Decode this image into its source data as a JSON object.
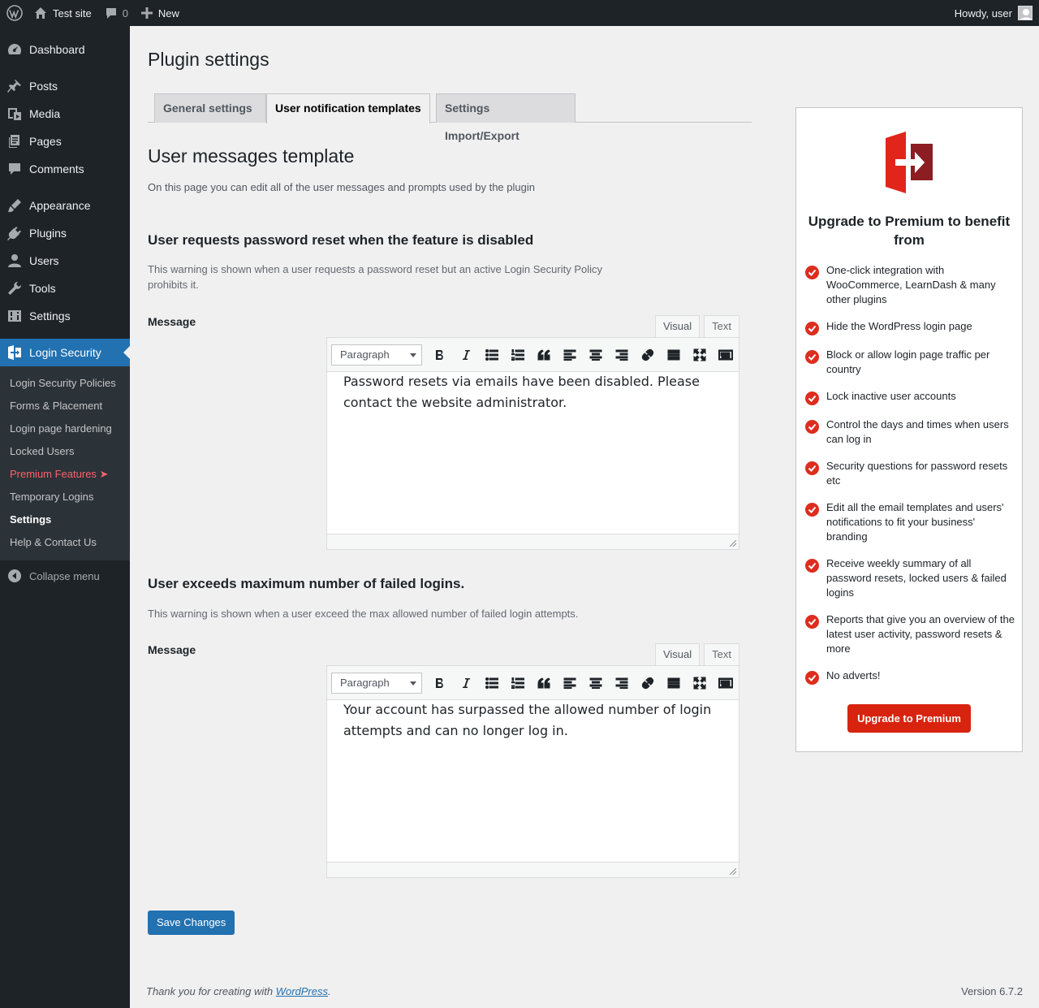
{
  "adminbar": {
    "site_name": "Test site",
    "comments_count": "0",
    "new_label": "New",
    "howdy": "Howdy, user"
  },
  "sidebar": {
    "items": [
      {
        "label": "Dashboard",
        "icon": "dashboard-icon"
      },
      {
        "label": "Posts",
        "icon": "pin-icon"
      },
      {
        "label": "Media",
        "icon": "media-icon"
      },
      {
        "label": "Pages",
        "icon": "pages-icon"
      },
      {
        "label": "Comments",
        "icon": "comment-icon"
      },
      {
        "label": "Appearance",
        "icon": "brush-icon"
      },
      {
        "label": "Plugins",
        "icon": "plug-icon"
      },
      {
        "label": "Users",
        "icon": "user-icon"
      },
      {
        "label": "Tools",
        "icon": "wrench-icon"
      },
      {
        "label": "Settings",
        "icon": "settings-icon"
      },
      {
        "label": "Login Security",
        "icon": "login-security-icon"
      }
    ],
    "submenu": [
      "Login Security Policies",
      "Forms & Placement",
      "Login page hardening",
      "Locked Users",
      "Premium Features ➤",
      "Temporary Logins",
      "Settings",
      "Help & Contact Us"
    ],
    "collapse_label": "Collapse menu"
  },
  "page": {
    "title": "Plugin settings",
    "tabs": [
      "General settings",
      "User notification templates",
      "Settings Import/Export"
    ],
    "section_title": "User messages template",
    "intro": "On this page you can edit all of the user messages and prompts used by the plugin"
  },
  "blocks": [
    {
      "title": "User requests password reset when the feature is disabled",
      "desc": "This warning is shown when a user requests a password reset but an active Login Security Policy prohibits it.",
      "message_label": "Message",
      "visual_tab": "Visual",
      "text_tab": "Text",
      "format": "Paragraph",
      "content": "Password resets via emails have been disabled. Please contact the website administrator."
    },
    {
      "title": "User exceeds maximum number of failed logins.",
      "desc": "This warning is shown when a user exceed the max allowed number of failed login attempts.",
      "message_label": "Message",
      "visual_tab": "Visual",
      "text_tab": "Text",
      "format": "Paragraph",
      "content": "Your account has surpassed the allowed number of login attempts and can no longer log in."
    }
  ],
  "save_label": "Save Changes",
  "footer": {
    "thanks_prefix": "Thank you for creating with ",
    "thanks_link": "WordPress",
    "thanks_suffix": ".",
    "version": "Version 6.7.2"
  },
  "premium": {
    "title": "Upgrade to Premium to benefit from",
    "features": [
      "One-click integration with WooCommerce, LearnDash & many other plugins",
      "Hide the WordPress login page",
      "Block or allow login page traffic per country",
      "Lock inactive user accounts",
      "Control the days and times when users can log in",
      "Security questions for password resets etc",
      "Edit all the email templates and users' notifications to fit your business' branding",
      "Receive weekly summary of all password resets, locked users & failed logins",
      "Reports that give you an overview of the latest user activity, password resets & more",
      "No adverts!"
    ],
    "button": "Upgrade to Premium",
    "accent_color": "#d8230f"
  },
  "colors": {
    "admin_bar": "#1d2327",
    "primary": "#2271b1",
    "premium_link": "#f86368"
  }
}
